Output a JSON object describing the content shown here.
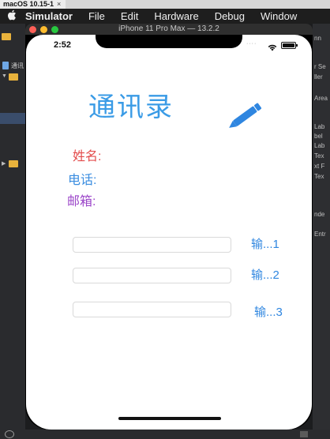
{
  "vm": {
    "title": "macOS 10.15-1",
    "close": "×"
  },
  "menubar": {
    "apple": "",
    "items": [
      "Simulator",
      "File",
      "Edit",
      "Hardware",
      "Debug",
      "Window"
    ]
  },
  "navigator": {
    "rows": [
      "通讯"
    ]
  },
  "inspector": {
    "texts": [
      "nn",
      "r Se",
      "ller",
      "Area",
      "Lab",
      "bel",
      "Lab",
      "Tex",
      "xt F",
      "Tex",
      "nde",
      "Entr"
    ]
  },
  "simulator": {
    "title": "iPhone 11 Pro Max — 13.2.2"
  },
  "status": {
    "time": "2:52",
    "dots": "····"
  },
  "app": {
    "title": "通讯录",
    "labels": {
      "name": "姓名:",
      "phone": "电话:",
      "email": "邮箱:"
    },
    "inputs": [
      {
        "value": "",
        "placeholder": ""
      },
      {
        "value": "",
        "placeholder": ""
      },
      {
        "value": "",
        "placeholder": ""
      }
    ],
    "buttons": [
      "输...1",
      "输...2",
      "输...3"
    ]
  },
  "colors": {
    "title": "#3a9be6",
    "name_label": "#e34c4c",
    "phone_label": "#3a8de0",
    "email_label": "#9b45c9",
    "button": "#2f86e0"
  },
  "icons": {
    "pencil": "pencil-icon",
    "wifi": "wifi-icon",
    "battery": "battery-icon",
    "apple": "apple-logo-icon"
  }
}
